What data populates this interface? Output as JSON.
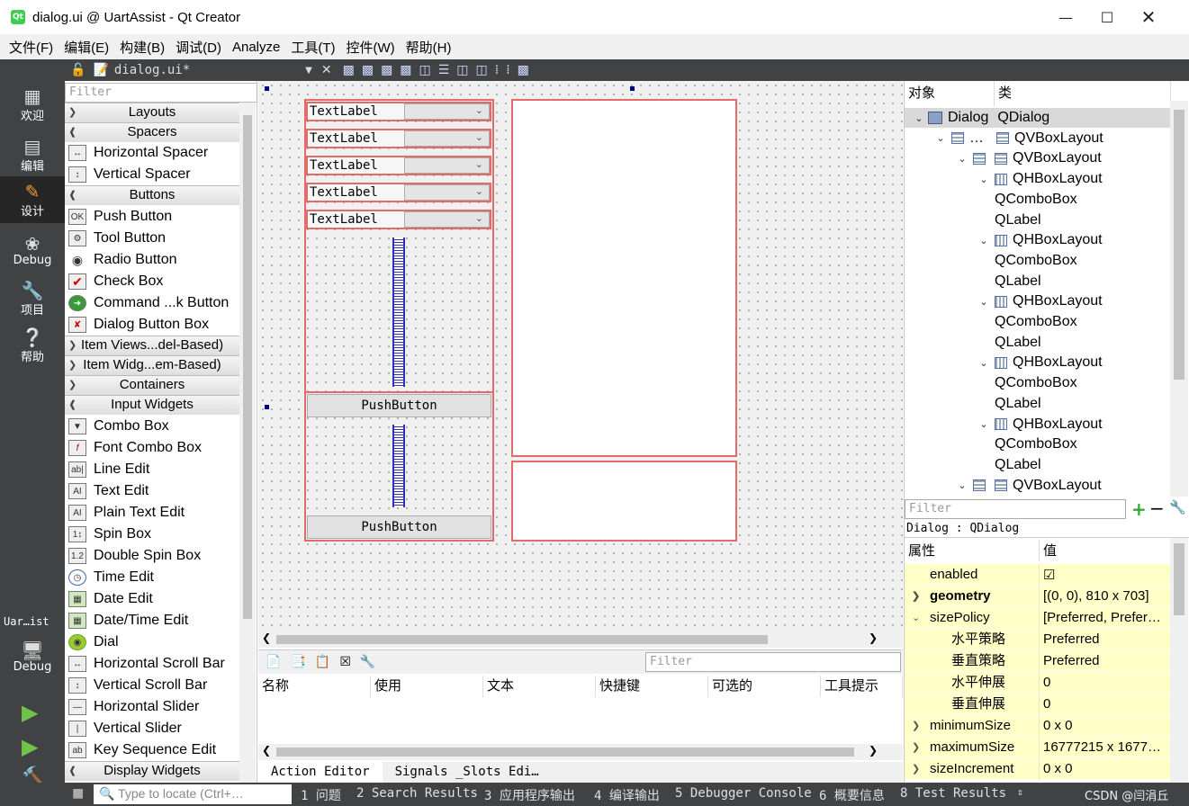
{
  "window": {
    "title": "dialog.ui @ UartAssist - Qt Creator",
    "app_icon": "Qt"
  },
  "menu": [
    "文件(F)",
    "编辑(E)",
    "构建(B)",
    "调试(D)",
    "Analyze",
    "工具(T)",
    "控件(W)",
    "帮助(H)"
  ],
  "modes": [
    {
      "label": "欢迎",
      "icon": "grid-icon"
    },
    {
      "label": "编辑",
      "icon": "edit-doc-icon"
    },
    {
      "label": "设计",
      "icon": "pencil-icon"
    },
    {
      "label": "Debug",
      "icon": "bug-icon"
    },
    {
      "label": "项目",
      "icon": "wrench-icon"
    },
    {
      "label": "帮助",
      "icon": "help-icon"
    }
  ],
  "kit": {
    "project": "Uar…ist",
    "config": "Debug"
  },
  "editor": {
    "filename": "dialog.ui*"
  },
  "widgetbox": {
    "filter_placeholder": "Filter",
    "categories": {
      "layouts": "Layouts",
      "spacers": "Spacers",
      "buttons": "Buttons",
      "itemviews": "Item Views...del-Based)",
      "itemwidgets": "Item Widg...em-Based)",
      "containers": "Containers",
      "inputwidgets": "Input Widgets",
      "displaywidgets": "Display Widgets"
    },
    "spacers": [
      "Horizontal Spacer",
      "Vertical Spacer"
    ],
    "buttons": [
      "Push Button",
      "Tool Button",
      "Radio Button",
      "Check Box",
      "Command ...k Button",
      "Dialog Button Box"
    ],
    "inputs": [
      "Combo Box",
      "Font Combo Box",
      "Line Edit",
      "Text Edit",
      "Plain Text Edit",
      "Spin Box",
      "Double Spin Box",
      "Time Edit",
      "Date Edit",
      "Date/Time Edit",
      "Dial",
      "Horizontal Scroll Bar",
      "Vertical Scroll Bar",
      "Horizontal Slider",
      "Vertical Slider",
      "Key Sequence Edit"
    ]
  },
  "form": {
    "labels": [
      "TextLabel",
      "TextLabel",
      "TextLabel",
      "TextLabel",
      "TextLabel"
    ],
    "buttons": [
      "PushButton",
      "PushButton"
    ]
  },
  "action_editor": {
    "filter_placeholder": "Filter",
    "columns": [
      "名称",
      "使用",
      "文本",
      "快捷键",
      "可选的",
      "工具提示"
    ],
    "tabs": [
      "Action Editor",
      "Signals _Slots Edi…"
    ]
  },
  "object_inspector": {
    "headers": [
      "对象",
      "类"
    ],
    "rows": [
      {
        "name": "Dialog",
        "cls": "QDialog"
      },
      {
        "name": "…",
        "cls": "QVBoxLayout"
      },
      {
        "name": "",
        "cls": "QVBoxLayout"
      },
      {
        "name": "",
        "cls": "QHBoxLayout"
      },
      {
        "name": "",
        "cls": "QComboBox"
      },
      {
        "name": "",
        "cls": "QLabel"
      },
      {
        "name": "",
        "cls": "QHBoxLayout"
      },
      {
        "name": "",
        "cls": "QComboBox"
      },
      {
        "name": "",
        "cls": "QLabel"
      },
      {
        "name": "",
        "cls": "QHBoxLayout"
      },
      {
        "name": "",
        "cls": "QComboBox"
      },
      {
        "name": "",
        "cls": "QLabel"
      },
      {
        "name": "",
        "cls": "QHBoxLayout"
      },
      {
        "name": "",
        "cls": "QComboBox"
      },
      {
        "name": "",
        "cls": "QLabel"
      },
      {
        "name": "",
        "cls": "QHBoxLayout"
      },
      {
        "name": "",
        "cls": "QComboBox"
      },
      {
        "name": "",
        "cls": "QLabel"
      },
      {
        "name": "",
        "cls": "QVBoxLayout"
      }
    ]
  },
  "property_editor": {
    "filter_placeholder": "Filter",
    "class_line": "Dialog : QDialog",
    "headers": [
      "属性",
      "值"
    ],
    "rows": [
      {
        "name": "enabled",
        "value": "☑"
      },
      {
        "name": "geometry",
        "value": "[(0, 0), 810 x 703]"
      },
      {
        "name": "sizePolicy",
        "value": "[Preferred, Prefer…"
      },
      {
        "name": "水平策略",
        "value": "Preferred"
      },
      {
        "name": "垂直策略",
        "value": "Preferred"
      },
      {
        "name": "水平伸展",
        "value": "0"
      },
      {
        "name": "垂直伸展",
        "value": "0"
      },
      {
        "name": "minimumSize",
        "value": "0 x 0"
      },
      {
        "name": "maximumSize",
        "value": "16777215 x 1677…"
      },
      {
        "name": "sizeIncrement",
        "value": "0 x 0"
      }
    ]
  },
  "statusbar": {
    "locate_placeholder": "Type to locate (Ctrl+…",
    "items": [
      "1 问题",
      "2 Search Results",
      "3 应用程序输出",
      "4 编译输出",
      "5 Debugger Console",
      "6 概要信息",
      "8 Test Results"
    ],
    "watermark": "CSDN @闫涓丘"
  }
}
